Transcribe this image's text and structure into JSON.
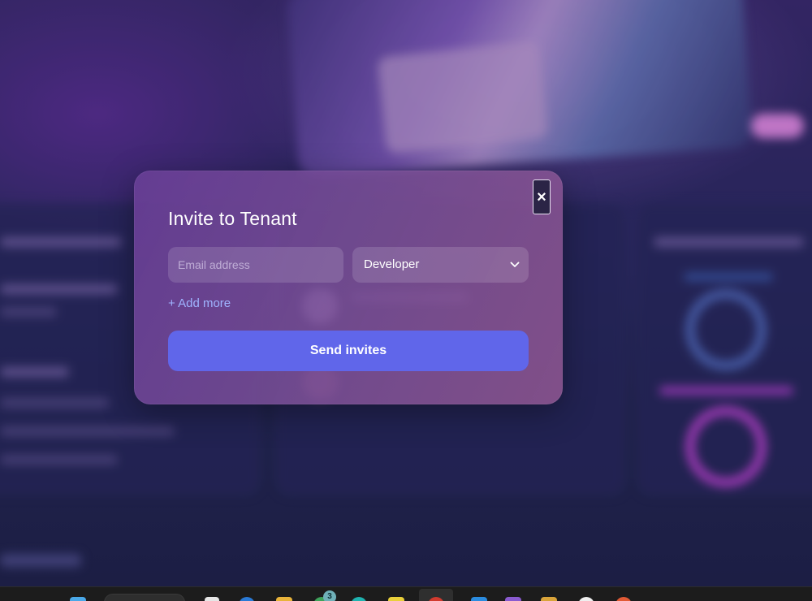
{
  "dialog": {
    "title": "Invite to Tenant",
    "close_label": "×",
    "email_placeholder": "Email address",
    "email_value": "",
    "role_selected": "Developer",
    "add_more_label": "+ Add more",
    "send_label": "Send invites"
  },
  "taskbar": {
    "notification_badge": "3"
  },
  "colors": {
    "primary_button": "#6066ea",
    "link": "#9fb4ff",
    "modal_tint": "#7a4e96"
  }
}
